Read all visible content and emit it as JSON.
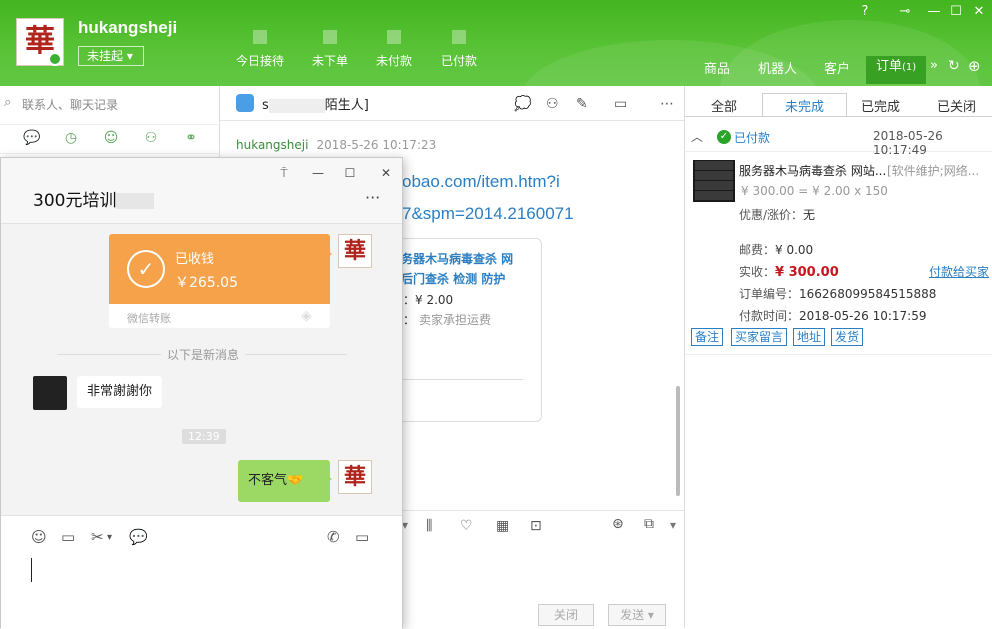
{
  "header": {
    "username": "hukangsheji",
    "status": "未挂起",
    "stats": [
      {
        "label": "今日接待"
      },
      {
        "label": "未下单"
      },
      {
        "label": "未付款"
      },
      {
        "label": "已付款"
      }
    ],
    "nav": [
      {
        "label": "商品"
      },
      {
        "label": "机器人"
      },
      {
        "label": "客户"
      },
      {
        "label": "订单",
        "badge": "(1)"
      }
    ],
    "window_icons": [
      "help-icon",
      "pin-icon",
      "minimize-icon",
      "maximize-icon",
      "close-icon"
    ]
  },
  "left": {
    "search_placeholder": "联系人、聊天记录"
  },
  "chat": {
    "title_start": "s",
    "title_end": "陌生人]",
    "sender": "hukangsheji",
    "time": "2018-5-26 10:17:23",
    "link_line1": "obao.com/item.htm?i",
    "link_line2": "7&spm=2014.2160071",
    "card_title": "务器木马病毒查杀 网后门查杀 检测 防护",
    "card_price": "格：¥ 2.00",
    "card_ship": "费：",
    "card_ship_value": "卖家承担运费",
    "close_label": "关闭",
    "send_label": "发送"
  },
  "orders": {
    "tabs": [
      "全部",
      "未完成",
      "已完成",
      "已关闭"
    ],
    "active_tab": "未完成",
    "status": "已付款",
    "datetime": "2018-05-26 10:17:49",
    "product_name": "服务器木马病毒查杀 网站...",
    "product_tag": "[软件维护;网络...",
    "price_line": "¥ 300.00 = ¥ 2.00 x 150",
    "discount_label": "优惠/涨价：",
    "discount_value": "无",
    "postage_label": "邮费：",
    "postage_value": "¥ 0.00",
    "actual_label": "实收：",
    "actual_value": "¥ 300.00",
    "pay_link": "付款给买家",
    "order_no_label": "订单编号：",
    "order_no": "166268099584515888",
    "pay_time_label": "付款时间：",
    "pay_time": "2018-05-26 10:17:59",
    "tags": [
      "备注",
      "买家留言",
      "地址",
      "发货"
    ]
  },
  "popup": {
    "title": "300元培训",
    "more": "···",
    "transfer_title": "已收钱",
    "transfer_amount": "￥265.05",
    "transfer_foot": "微信转账",
    "divider": "以下是新消息",
    "msg_left": "非常謝謝你",
    "time": "12:39",
    "msg_right": "不客气🤝"
  },
  "colors": {
    "header_green": "#58c235",
    "transfer_orange": "#f6a24b",
    "bubble_green": "#9bd964",
    "link_blue": "#2a7fc4",
    "price_red": "#c7161e"
  }
}
